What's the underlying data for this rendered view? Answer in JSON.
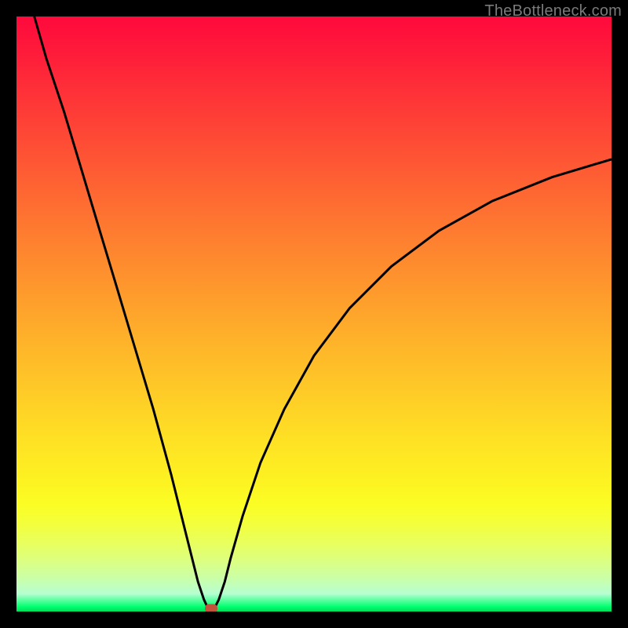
{
  "watermark": "TheBottleneck.com",
  "chart_data": {
    "type": "line",
    "title": "",
    "xlabel": "",
    "ylabel": "",
    "xlim": [
      0,
      1
    ],
    "ylim": [
      0,
      1
    ],
    "grid": false,
    "background_gradient": {
      "top": "#fe093c",
      "mid": "#fee324",
      "bottom": "#00ff6f"
    },
    "series": [
      {
        "name": "bottleneck-curve",
        "color": "#000000",
        "x": [
          0.03,
          0.05,
          0.08,
          0.11,
          0.14,
          0.17,
          0.2,
          0.23,
          0.26,
          0.285,
          0.305,
          0.315,
          0.322,
          0.327,
          0.335,
          0.34,
          0.35,
          0.36,
          0.38,
          0.41,
          0.45,
          0.5,
          0.56,
          0.63,
          0.71,
          0.8,
          0.9,
          1.0
        ],
        "y": [
          1.0,
          0.93,
          0.84,
          0.74,
          0.64,
          0.54,
          0.44,
          0.34,
          0.23,
          0.13,
          0.05,
          0.02,
          0.005,
          0.005,
          0.01,
          0.02,
          0.05,
          0.09,
          0.16,
          0.25,
          0.34,
          0.43,
          0.51,
          0.58,
          0.64,
          0.69,
          0.73,
          0.76
        ]
      }
    ],
    "marker": {
      "x": 0.327,
      "y": 0.005,
      "color": "#c1543b"
    }
  }
}
